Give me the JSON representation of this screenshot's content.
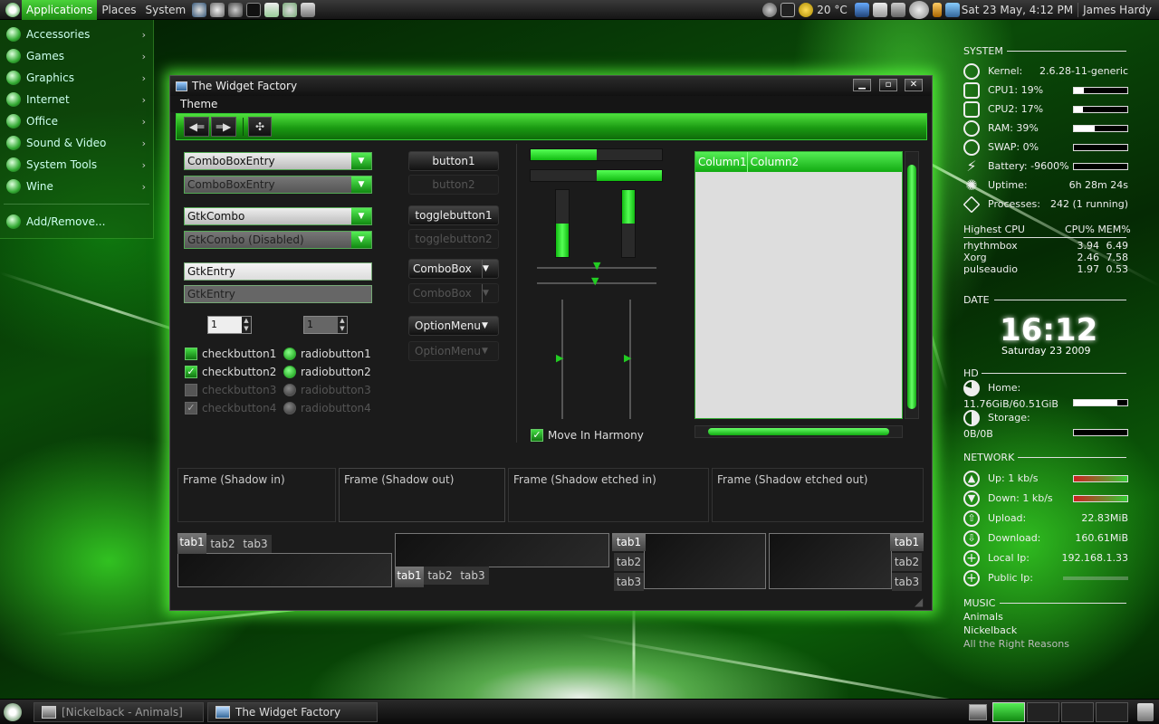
{
  "top_panel": {
    "menus": [
      "Applications",
      "Places",
      "System"
    ],
    "launchers": [
      "firefox-icon",
      "gimp-icon",
      "chat-icon",
      "terminal-icon",
      "editor-icon",
      "pidgin-icon",
      "keyboard-icon"
    ],
    "weather": "20 °C",
    "datetime": "Sat 23 May,  4:12 PM",
    "user": "James Hardy"
  },
  "apps_menu": {
    "items": [
      "Accessories",
      "Games",
      "Graphics",
      "Internet",
      "Office",
      "Sound & Video",
      "System Tools",
      "Wine"
    ],
    "add_remove": "Add/Remove..."
  },
  "window": {
    "title": "The Widget Factory",
    "menu": "Theme",
    "combos": [
      "ComboBoxEntry",
      "ComboBoxEntry",
      "GtkCombo",
      "GtkCombo (Disabled)"
    ],
    "entries": [
      "GtkEntry",
      "GtkEntry"
    ],
    "spin_values": [
      "1",
      "1"
    ],
    "checkboxes": [
      "checkbutton1",
      "checkbutton2",
      "checkbutton3",
      "checkbutton4"
    ],
    "radios": [
      "radiobutton1",
      "radiobutton2",
      "radiobutton3",
      "radiobutton4"
    ],
    "buttons": {
      "button1": "button1",
      "button2": "button2",
      "toggle1": "togglebutton1",
      "toggle2": "togglebutton2",
      "combobox1": "ComboBox",
      "combobox2": "ComboBox",
      "optionmenu1": "OptionMenu",
      "optionmenu2": "OptionMenu"
    },
    "progress": {
      "h1": 0.5,
      "h2": 0.5,
      "v1": 0.5,
      "v2": 0.5
    },
    "move_in_harmony": "Move In Harmony",
    "tree_columns": [
      "Column1",
      "Column2"
    ],
    "frames": [
      "Frame (Shadow in)",
      "Frame (Shadow out)",
      "Frame (Shadow etched in)",
      "Frame (Shadow etched out)"
    ],
    "tabs": [
      "tab1",
      "tab2",
      "tab3"
    ]
  },
  "conky": {
    "system_title": "SYSTEM",
    "kernel_label": "Kernel:",
    "kernel": "2.6.28-11-generic",
    "cpu1": "CPU1: 19%",
    "cpu1_frac": 0.19,
    "cpu2": "CPU2: 17%",
    "cpu2_frac": 0.17,
    "ram": "RAM: 39%",
    "ram_frac": 0.39,
    "swap": "SWAP: 0%",
    "swap_frac": 0,
    "battery": "Battery: -9600%",
    "battery_frac": 0,
    "uptime_label": "Uptime:",
    "uptime": "6h 28m 24s",
    "processes_label": "Processes:",
    "processes": "242 (1 running)",
    "highest_cpu": "Highest CPU",
    "cpu_mem_header": "CPU% MEM%",
    "top_procs": [
      {
        "name": "rhythmbox",
        "cpu": "3.94",
        "mem": "6.49"
      },
      {
        "name": "Xorg",
        "cpu": "2.46",
        "mem": "7.58"
      },
      {
        "name": "pulseaudio",
        "cpu": "1.97",
        "mem": "0.53"
      }
    ],
    "date_title": "DATE",
    "time": "16:12",
    "date": "Saturday 23 2009",
    "hd_title": "HD",
    "home_label": "Home:",
    "home_value": "11.76GiB/60.51GiB",
    "home_frac": 0.81,
    "storage_label": "Storage:",
    "storage_value": "0B/0B",
    "storage_frac": 0,
    "network_title": "NETWORK",
    "up": "Up: 1 kb/s",
    "down": "Down: 1 kb/s",
    "upload_label": "Upload:",
    "upload": "22.83MiB",
    "download_label": "Download:",
    "download": "160.61MiB",
    "local_ip_label": "Local Ip:",
    "local_ip": "192.168.1.33",
    "public_ip_label": "Public Ip:",
    "music_title": "MUSIC",
    "song": "Animals",
    "artist": "Nickelback",
    "album": "All the Right Reasons"
  },
  "taskbar": {
    "tasks": [
      "[Nickelback - Animals]",
      "The Widget Factory"
    ]
  },
  "colors": {
    "accent": "#2cc41c",
    "panel": "#1a1a1a",
    "window_bg": "#1b1b1b"
  }
}
